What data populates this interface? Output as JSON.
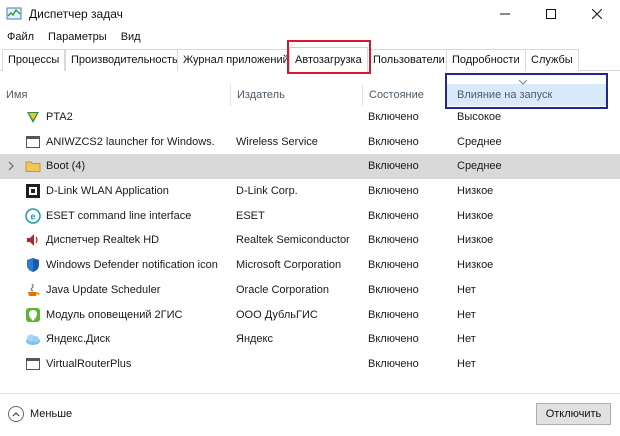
{
  "window": {
    "title": "Диспетчер задач",
    "icon": "task-manager-icon",
    "controls": [
      "minimize-icon",
      "maximize-icon",
      "close-icon"
    ]
  },
  "menu": {
    "items": [
      "Файл",
      "Параметры",
      "Вид"
    ]
  },
  "tabs": [
    {
      "label": "Процессы",
      "active": false
    },
    {
      "label": "Производительность",
      "active": false
    },
    {
      "label": "Журнал приложений",
      "active": false
    },
    {
      "label": "Автозагрузка",
      "active": true
    },
    {
      "label": "Пользователи",
      "active": false
    },
    {
      "label": "Подробности",
      "active": false
    },
    {
      "label": "Службы",
      "active": false
    }
  ],
  "table": {
    "headers": {
      "name": "Имя",
      "publisher": "Издатель",
      "state": "Состояние",
      "impact": "Влияние на запуск"
    },
    "sorted_column": "impact",
    "rows": [
      {
        "name": "PTA2",
        "publisher": "",
        "state": "Включено",
        "impact": "Высокое",
        "icon": "shield-app-icon"
      },
      {
        "name": "ANIWZCS2 launcher for Windows.",
        "publisher": "Wireless Service",
        "state": "Включено",
        "impact": "Среднее",
        "icon": "app-window-icon"
      },
      {
        "name": "Boot (4)",
        "publisher": "",
        "state": "Включено",
        "impact": "Среднее",
        "icon": "folder-icon",
        "expandable": true,
        "selected": true
      },
      {
        "name": "D-Link WLAN Application",
        "publisher": "D-Link Corp.",
        "state": "Включено",
        "impact": "Низкое",
        "icon": "dlink-icon"
      },
      {
        "name": "ESET command line interface",
        "publisher": "ESET",
        "state": "Включено",
        "impact": "Низкое",
        "icon": "eset-icon"
      },
      {
        "name": "Диспетчер Realtek HD",
        "publisher": "Realtek Semiconductor",
        "state": "Включено",
        "impact": "Низкое",
        "icon": "speaker-icon"
      },
      {
        "name": "Windows Defender notification icon",
        "publisher": "Microsoft Corporation",
        "state": "Включено",
        "impact": "Низкое",
        "icon": "defender-icon"
      },
      {
        "name": "Java Update Scheduler",
        "publisher": "Oracle Corporation",
        "state": "Включено",
        "impact": "Нет",
        "icon": "java-icon"
      },
      {
        "name": "Модуль оповещений 2ГИС",
        "publisher": "ООО ДубльГИС",
        "state": "Включено",
        "impact": "Нет",
        "icon": "2gis-icon"
      },
      {
        "name": "Яндекс.Диск",
        "publisher": "Яндекс",
        "state": "Включено",
        "impact": "Нет",
        "icon": "yandex-disk-icon"
      },
      {
        "name": "VirtualRouterPlus",
        "publisher": "",
        "state": "Включено",
        "impact": "Нет",
        "icon": "app-window-icon"
      }
    ]
  },
  "footer": {
    "fewer_label": "Меньше",
    "disable_label": "Отключить"
  },
  "colors": {
    "active_tab_highlight": "#d4192d",
    "sort_column_highlight": "#1f2a8c",
    "sorted_column_bg": "#d9ebfa",
    "selected_row_bg": "#d9d9d9"
  }
}
